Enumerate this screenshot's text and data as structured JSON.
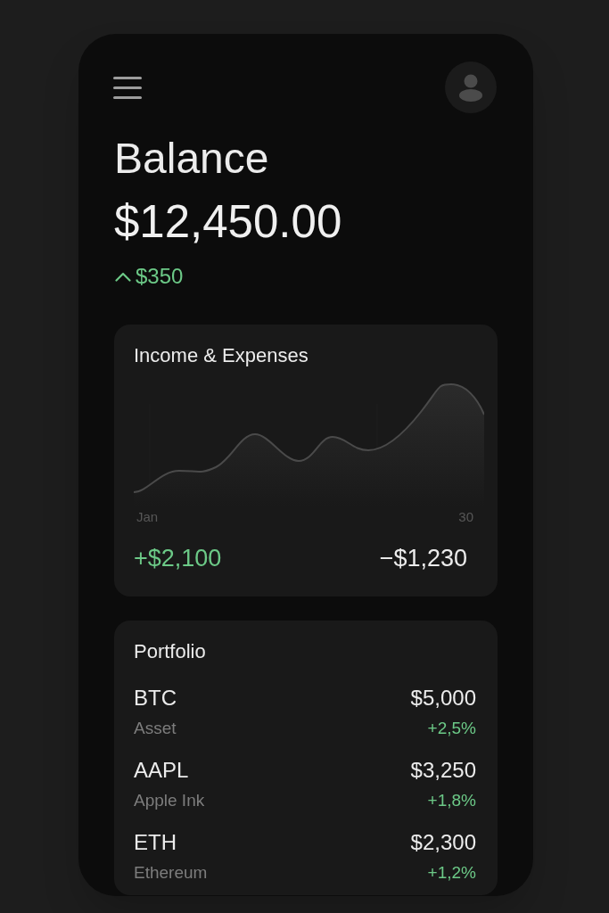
{
  "balance": {
    "title": "Balance",
    "amount": "$12,450.00",
    "change": "$350",
    "positive": true
  },
  "income_expenses": {
    "title": "Income & Expenses",
    "x_start": "Jan",
    "x_end": "30",
    "income": "+$2,100",
    "expenses": "−$1,230"
  },
  "portfolio": {
    "title": "Portfolio",
    "items": [
      {
        "symbol": "BTC",
        "name": "Asset",
        "value": "$5,000",
        "change": "+2,5%",
        "positive": true
      },
      {
        "symbol": "AAPL",
        "name": "Apple Ink",
        "value": "$3,250",
        "change": "+1,8%",
        "positive": true
      },
      {
        "symbol": "ETH",
        "name": "Ethereum",
        "value": "$2,300",
        "change": "+1,2%",
        "positive": true
      }
    ]
  }
}
